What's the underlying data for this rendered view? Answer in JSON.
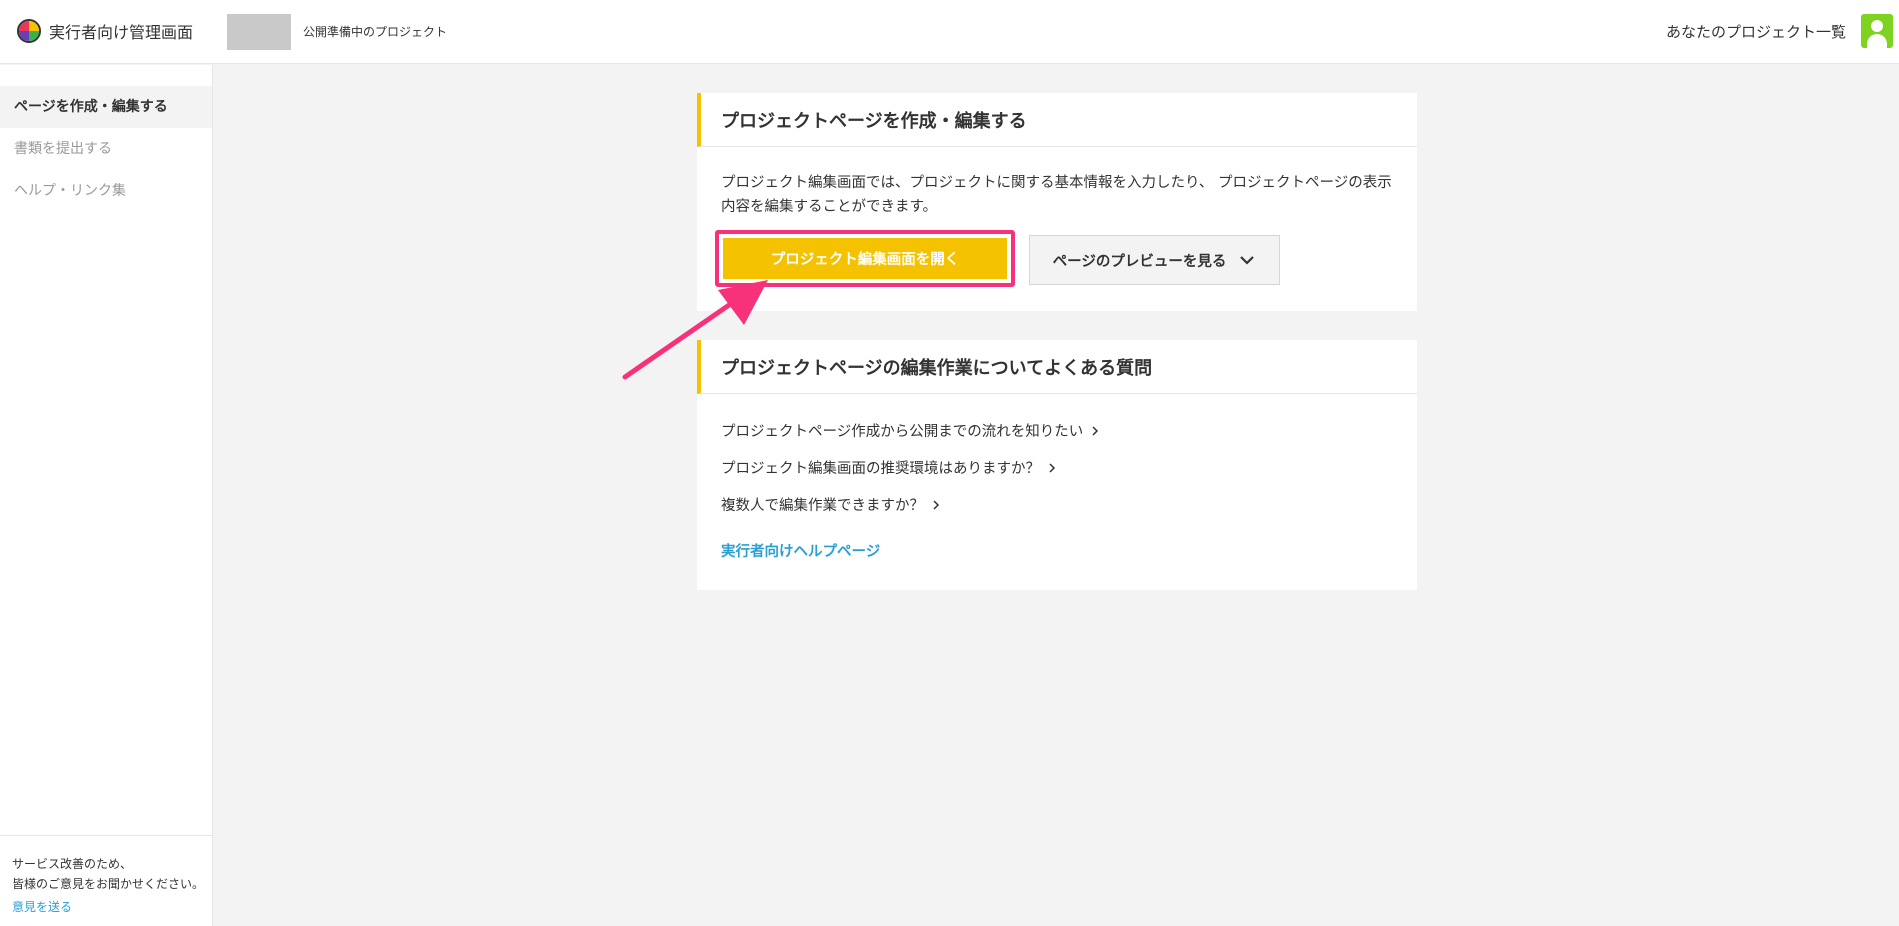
{
  "header": {
    "app_title": "実行者向け管理画面",
    "project_status": "公開準備中のプロジェクト",
    "nav_projects": "あなたのプロジェクト一覧"
  },
  "sidebar": {
    "items": [
      {
        "label": "ページを作成・編集する",
        "active": true
      },
      {
        "label": "書類を提出する",
        "active": false
      },
      {
        "label": "ヘルプ・リンク集",
        "active": false
      }
    ],
    "feedback": {
      "line1": "サービス改善のため、",
      "line2": "皆様のご意見をお聞かせください。",
      "link": "意見を送る"
    }
  },
  "main": {
    "create_card": {
      "title": "プロジェクトページを作成・編集する",
      "description": "プロジェクト編集画面では、プロジェクトに関する基本情報を入力したり、 プロジェクトページの表示内容を編集することができます。",
      "primary_button": "プロジェクト編集画面を開く",
      "preview_button": "ページのプレビューを見る"
    },
    "faq_card": {
      "title": "プロジェクトページの編集作業についてよくある質問",
      "questions": [
        "プロジェクトページ作成から公開までの流れを知りたい",
        "プロジェクト編集画面の推奨環境はありますか？",
        "複数人で編集作業できますか？"
      ],
      "help_link": "実行者向けヘルプページ"
    }
  },
  "colors": {
    "accent": "#f5c200",
    "highlight": "#f7317a",
    "link": "#2a9fd6",
    "avatar": "#7ed321"
  }
}
